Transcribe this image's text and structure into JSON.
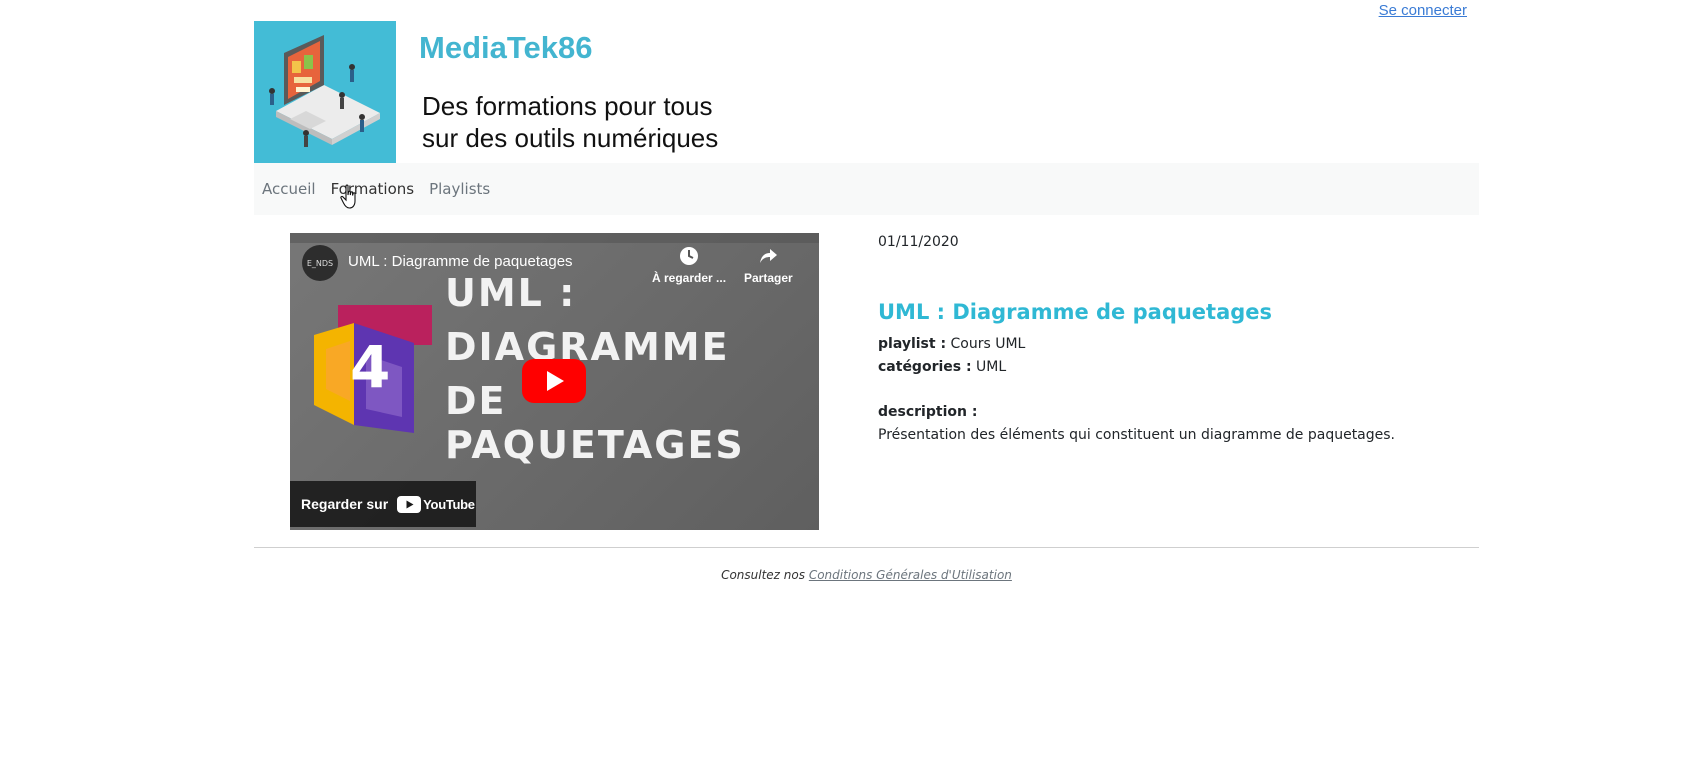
{
  "header": {
    "login_link": "Se connecter",
    "brand": "MediaTek86",
    "tagline_line1": "Des formations pour tous",
    "tagline_line2": "sur des outils numériques"
  },
  "nav": {
    "items": [
      {
        "label": "Accueil"
      },
      {
        "label": "Formations"
      },
      {
        "label": "Playlists"
      }
    ]
  },
  "video": {
    "channel": "E_NDS",
    "title": "UML : Diagramme de paquetages",
    "watch_later": "À regarder ...",
    "share": "Partager",
    "overlay_line1": "UML :",
    "overlay_line2": "DIAGRAMME",
    "overlay_line3": "DE PAQUETAGES",
    "logo_number": "4",
    "watch_on": "Regarder sur",
    "platform": "YouTube"
  },
  "formation": {
    "date": "01/11/2020",
    "title": "UML : Diagramme de paquetages",
    "playlist_label": "playlist :",
    "playlist_value": "Cours UML",
    "categories_label": "catégories :",
    "categories_value": "UML",
    "description_label": "description :",
    "description_value": "Présentation des éléments qui constituent un diagramme de paquetages."
  },
  "footer": {
    "prefix": "Consultez nos",
    "link": "Conditions Générales d'Utilisation"
  },
  "colors": {
    "brand": "#43b5d0",
    "title": "#2fb8d4",
    "link": "#3a7bd5",
    "youtube_red": "#ff0000"
  }
}
